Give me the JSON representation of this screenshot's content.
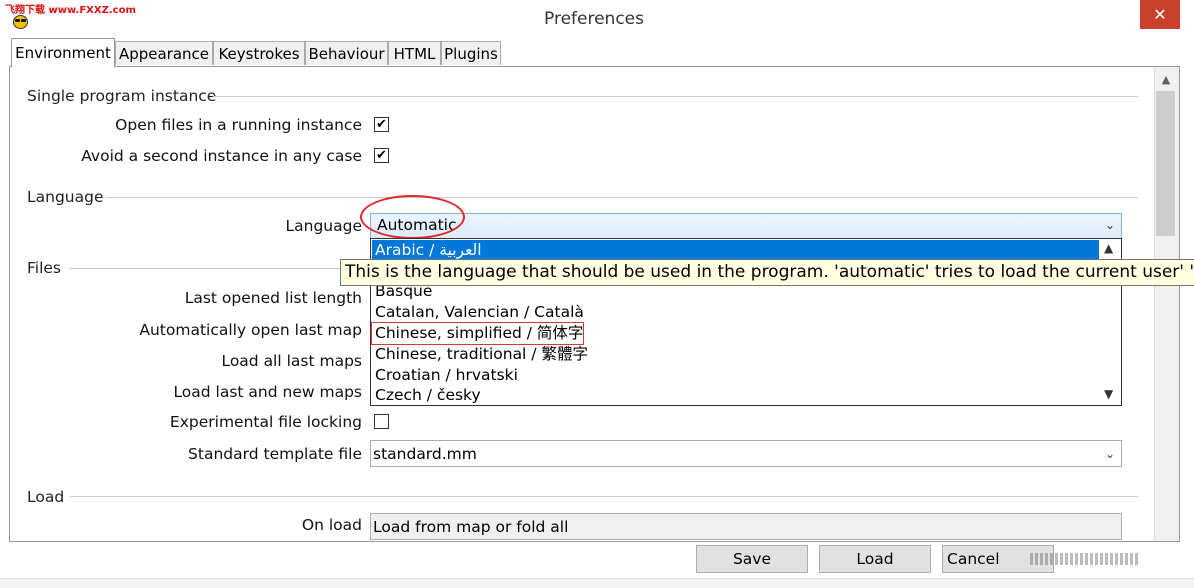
{
  "watermark": {
    "text": "飞翔下载 www.FXXZ.com"
  },
  "window": {
    "title": "Preferences",
    "close_glyph": "✕"
  },
  "tabs": [
    {
      "label": "Environment",
      "active": true
    },
    {
      "label": "Appearance"
    },
    {
      "label": "Keystrokes"
    },
    {
      "label": "Behaviour"
    },
    {
      "label": "HTML"
    },
    {
      "label": "Plugins"
    }
  ],
  "sections": {
    "single_instance": "Single program instance",
    "language": "Language",
    "files": "Files",
    "load": "Load"
  },
  "single_instance": {
    "open_files_label": "Open files in a running instance",
    "open_files_checked": true,
    "avoid_second_label": "Avoid a second instance in any case",
    "avoid_second_checked": true
  },
  "language": {
    "label": "Language",
    "value": "Automatic",
    "options": [
      "Arabic / العربية",
      "Basque",
      "Catalan, Valencian / Català",
      "Chinese, simplified / 简体字",
      "Chinese, traditional / 繁體字",
      "Croatian / hrvatski",
      "Czech / česky"
    ],
    "tooltip": "This is the language that should be used in the program. 'automatic' tries to load the current user' '"
  },
  "files": {
    "last_opened_label": "Last opened list length",
    "auto_open_label": "Automatically open last map",
    "load_all_label": "Load all last maps",
    "load_last_new_label": "Load last and new maps",
    "experimental_lock_label": "Experimental file locking",
    "experimental_lock_checked": false,
    "template_label": "Standard template file",
    "template_value": "standard.mm"
  },
  "load": {
    "on_load_label": "On load",
    "on_load_value": "Load from map or fold all"
  },
  "buttons": {
    "save": "Save",
    "load": "Load",
    "cancel": "Cancel"
  },
  "icons": {
    "checkmark": "✔",
    "caret_down": "⌄",
    "scroll_up": "▲",
    "scroll_down": "▼"
  },
  "colors": {
    "selection": "#0078d7",
    "tooltip_bg": "#ffffe1",
    "close_bg": "#c7412c",
    "annotation": "#e0292b"
  }
}
